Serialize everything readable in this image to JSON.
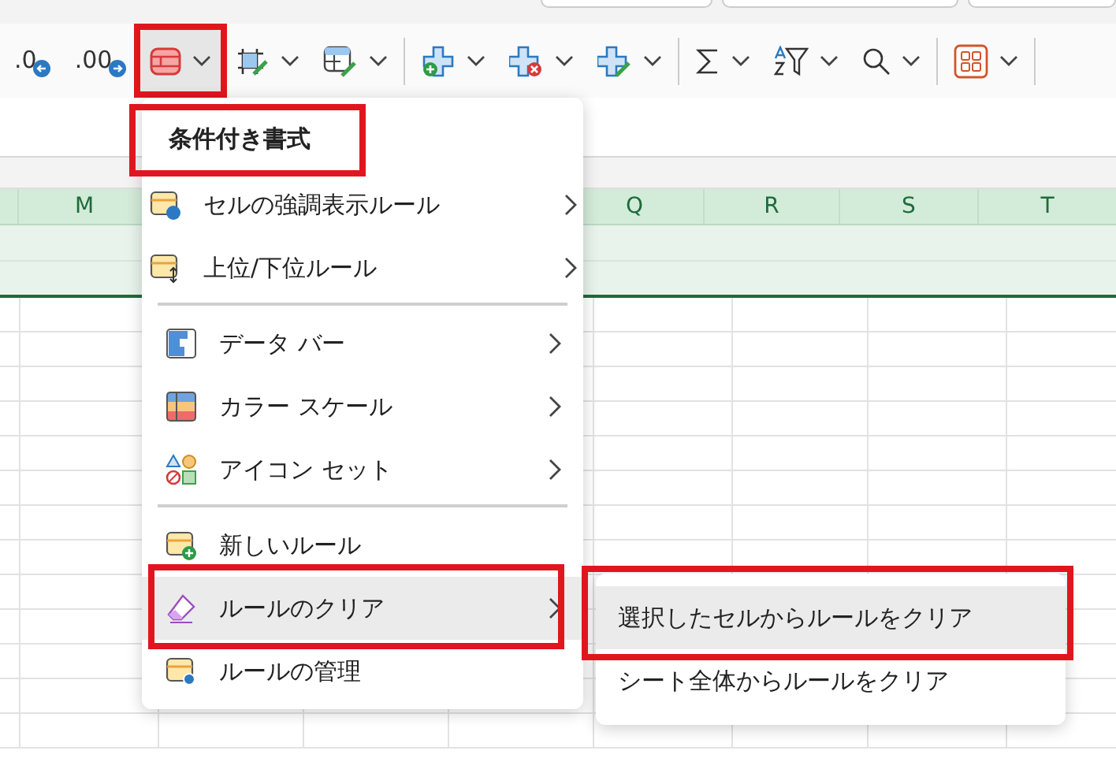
{
  "toolbar": {
    "items": [
      {
        "kind": "decimal-decrease",
        "label": ".0",
        "selected": false,
        "dropdown": false,
        "highlighted": false
      },
      {
        "kind": "decimal-increase",
        "label": ".00",
        "selected": false,
        "dropdown": false,
        "highlighted": false
      },
      {
        "kind": "conditional-format",
        "selected": true,
        "dropdown": true,
        "highlighted": true
      },
      {
        "kind": "borders",
        "selected": false,
        "dropdown": true,
        "highlighted": false
      },
      {
        "kind": "table-format",
        "selected": false,
        "dropdown": true,
        "highlighted": false,
        "separator_after": true
      },
      {
        "kind": "insert",
        "selected": false,
        "dropdown": true,
        "highlighted": false
      },
      {
        "kind": "delete",
        "selected": false,
        "dropdown": true,
        "highlighted": false
      },
      {
        "kind": "format",
        "selected": false,
        "dropdown": true,
        "highlighted": false,
        "separator_after": true
      },
      {
        "kind": "sum",
        "selected": false,
        "dropdown": true,
        "highlighted": false
      },
      {
        "kind": "sort-filter",
        "selected": false,
        "dropdown": true,
        "highlighted": false
      },
      {
        "kind": "find",
        "selected": false,
        "dropdown": true,
        "highlighted": false,
        "separator_after": true
      },
      {
        "kind": "addins",
        "selected": false,
        "dropdown": true,
        "highlighted": false,
        "separator_after": true
      }
    ]
  },
  "sheet": {
    "columns": [
      {
        "label": "M"
      },
      {
        "label": "Q"
      },
      {
        "label": "R"
      },
      {
        "label": "S"
      },
      {
        "label": "T"
      }
    ]
  },
  "menu": {
    "title": "条件付き書式",
    "title_highlighted": true,
    "groups": [
      [
        {
          "kind": "highlight-rules",
          "label": "セルの強調表示ルール",
          "submenu": true,
          "selected": false,
          "highlighted": false
        },
        {
          "kind": "top-bottom",
          "label": "上位/下位ルール",
          "submenu": true,
          "selected": false,
          "highlighted": false
        }
      ],
      [
        {
          "kind": "data-bar",
          "label": "データ バー",
          "submenu": true,
          "selected": false,
          "highlighted": false
        },
        {
          "kind": "color-scale",
          "label": "カラー スケール",
          "submenu": true,
          "selected": false,
          "highlighted": false
        },
        {
          "kind": "icon-set",
          "label": "アイコン セット",
          "submenu": true,
          "selected": false,
          "highlighted": false
        }
      ],
      [
        {
          "kind": "new-rule",
          "label": "新しいルール",
          "submenu": false,
          "selected": false,
          "highlighted": false
        },
        {
          "kind": "eraser",
          "label": "ルールのクリア",
          "submenu": true,
          "selected": true,
          "highlighted": true
        },
        {
          "kind": "manage",
          "label": "ルールの管理",
          "submenu": false,
          "selected": false,
          "highlighted": false
        }
      ]
    ]
  },
  "submenu": {
    "items": [
      {
        "label": "選択したセルからルールをクリア",
        "selected": true,
        "highlighted": true
      },
      {
        "label": "シート全体からルールをクリア",
        "selected": false,
        "highlighted": false
      }
    ]
  }
}
